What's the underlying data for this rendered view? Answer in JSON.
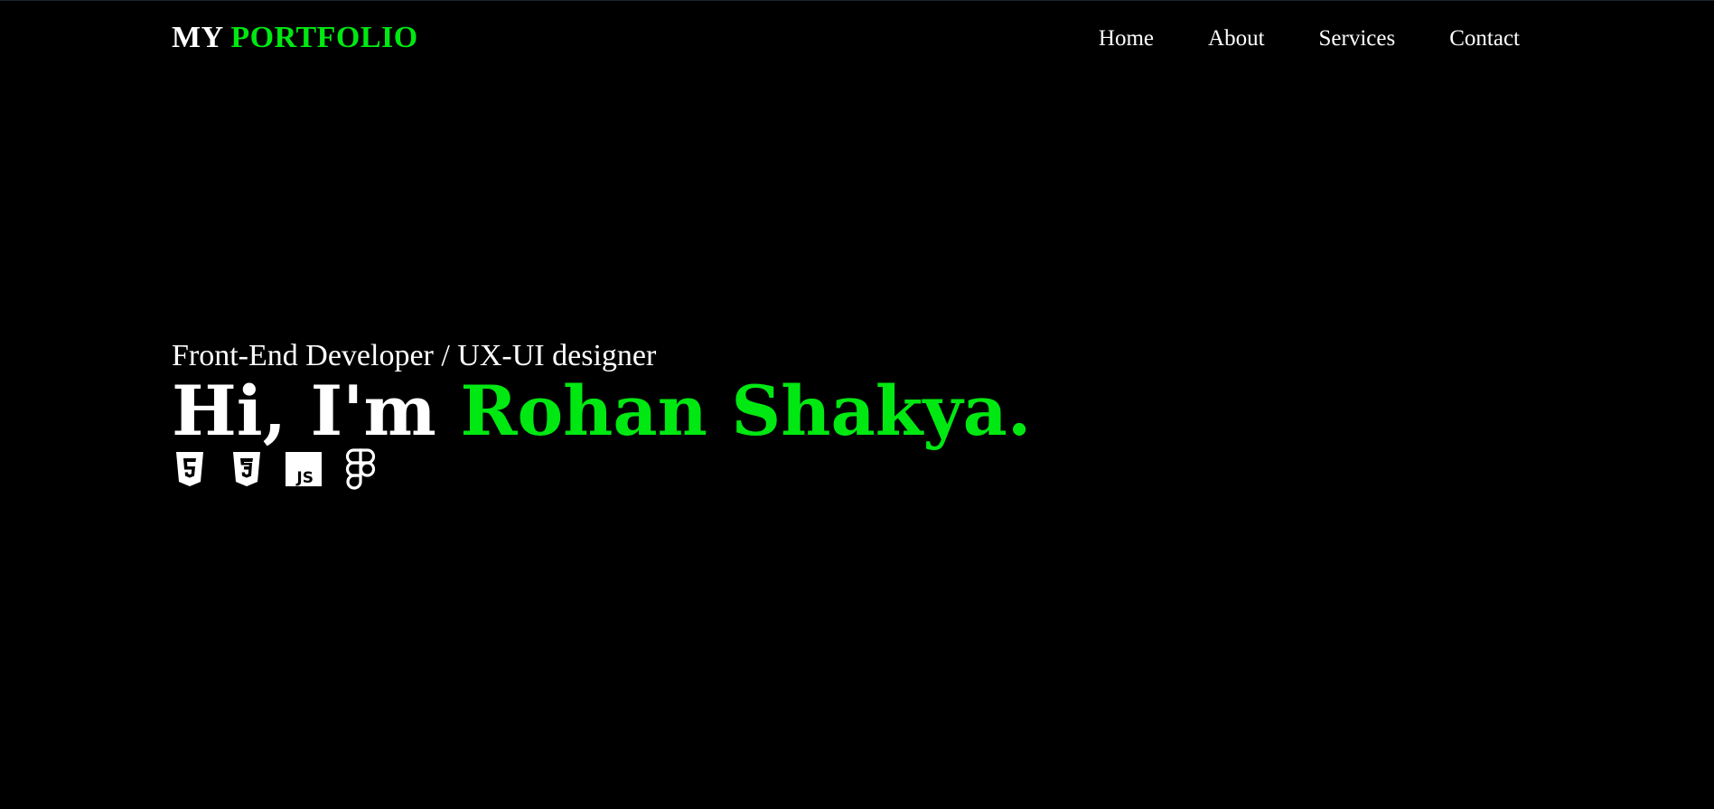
{
  "header": {
    "logo_part1": "MY",
    "logo_part2": "PORTFOLIO",
    "nav": [
      {
        "label": "Home"
      },
      {
        "label": "About"
      },
      {
        "label": "Services"
      },
      {
        "label": "Contact"
      }
    ]
  },
  "hero": {
    "subtitle": "Front-End Developer / UX-UI designer",
    "greeting": "Hi, I'm",
    "name": "Rohan Shakya.",
    "tech_icons": [
      "html5-icon",
      "css3-icon",
      "javascript-icon",
      "figma-icon"
    ],
    "js_icon_text": "JS"
  },
  "colors": {
    "background": "#000000",
    "text": "#ffffff",
    "accent": "#00e812"
  }
}
